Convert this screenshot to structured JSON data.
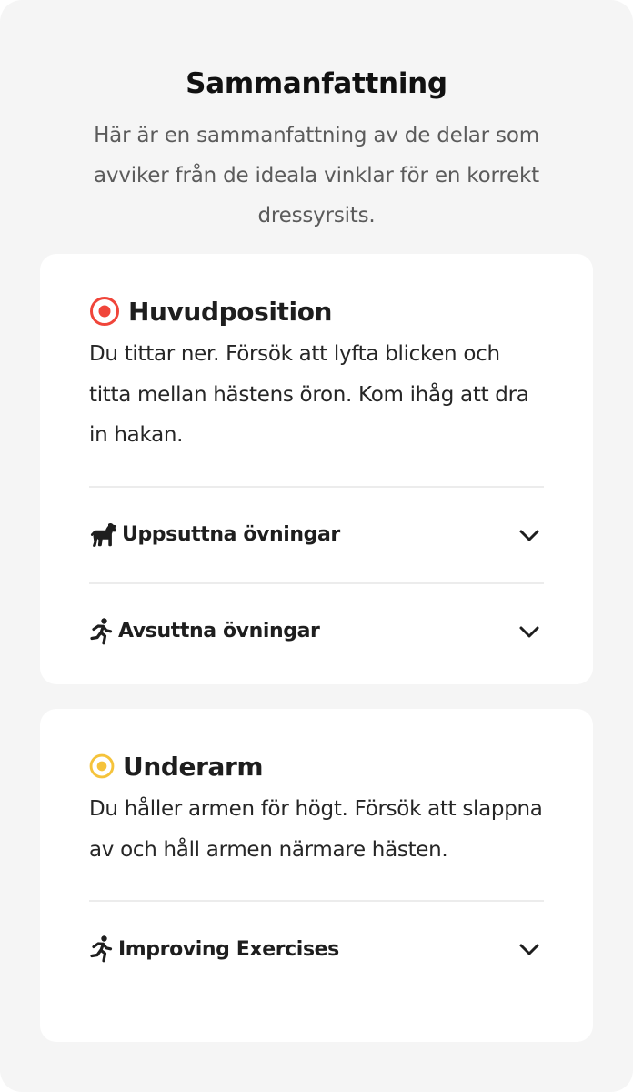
{
  "header": {
    "title": "Sammanfattning",
    "subtitle": "Här är en sammanfattning av de delar som avviker från de ideala vinklar för en korrekt dressyrsits."
  },
  "colors": {
    "severity_high": "#f0453a",
    "severity_medium": "#f5c33b",
    "page_background": "#f5f5f5",
    "card_background": "#ffffff"
  },
  "cards": [
    {
      "status_icon": "red-target-icon",
      "title": "Huvudposition",
      "description": "Du tittar ner. Försök att lyfta blicken och titta mellan hästens öron. Kom ihåg att dra in hakan.",
      "sections": [
        {
          "icon": "horse-icon",
          "label": "Uppsuttna övningar",
          "expand_icon": "chevron-down-icon"
        },
        {
          "icon": "running-person-icon",
          "label": "Avsuttna övningar",
          "expand_icon": "chevron-down-icon"
        }
      ]
    },
    {
      "status_icon": "yellow-target-icon",
      "title": "Underarm",
      "description": "Du håller armen för högt. Försök att slappna av och håll armen närmare hästen.",
      "sections": [
        {
          "icon": "running-person-icon",
          "label": "Improving Exercises",
          "expand_icon": "chevron-down-icon"
        }
      ]
    }
  ]
}
